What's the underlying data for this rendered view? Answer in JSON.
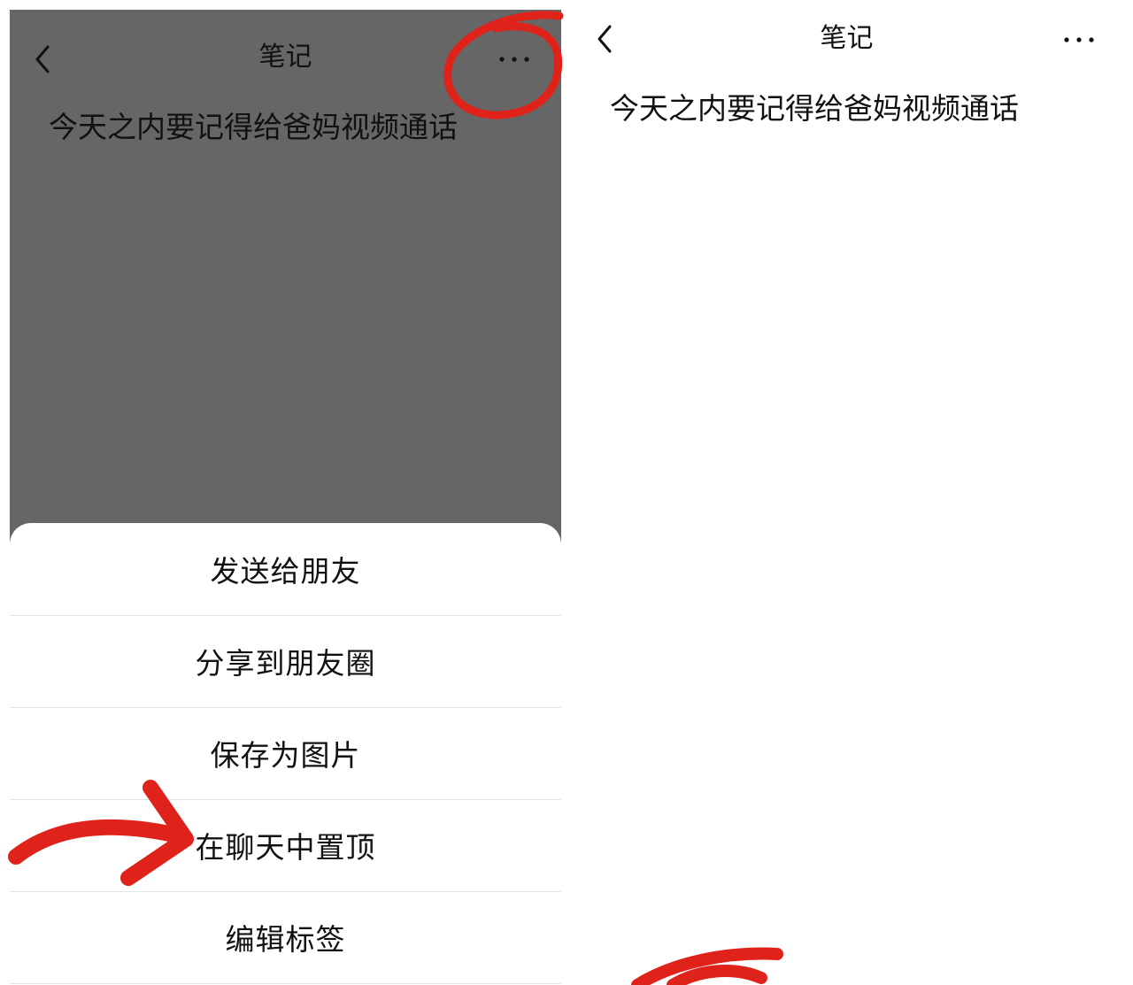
{
  "left_screen": {
    "header": {
      "title": "笔记",
      "back_icon": "chevron-left-icon",
      "more_icon": "more-horizontal-icon"
    },
    "note_text": "今天之内要记得给爸妈视频通话",
    "overlay_color": "#666666",
    "menu": {
      "items": [
        {
          "label": "发送给朋友"
        },
        {
          "label": "分享到朋友圈"
        },
        {
          "label": "保存为图片"
        },
        {
          "label": "在聊天中置顶"
        },
        {
          "label": "编辑标签"
        }
      ]
    }
  },
  "right_screen": {
    "header": {
      "title": "笔记",
      "back_icon": "chevron-left-icon",
      "more_icon": "more-horizontal-icon"
    },
    "note_text": "今天之内要记得给爸妈视频通话"
  },
  "annotations": {
    "color": "#e0231a",
    "marks": [
      "circle-around-more-button",
      "arrow-to-pin-in-chat",
      "scribble-bottom"
    ]
  }
}
